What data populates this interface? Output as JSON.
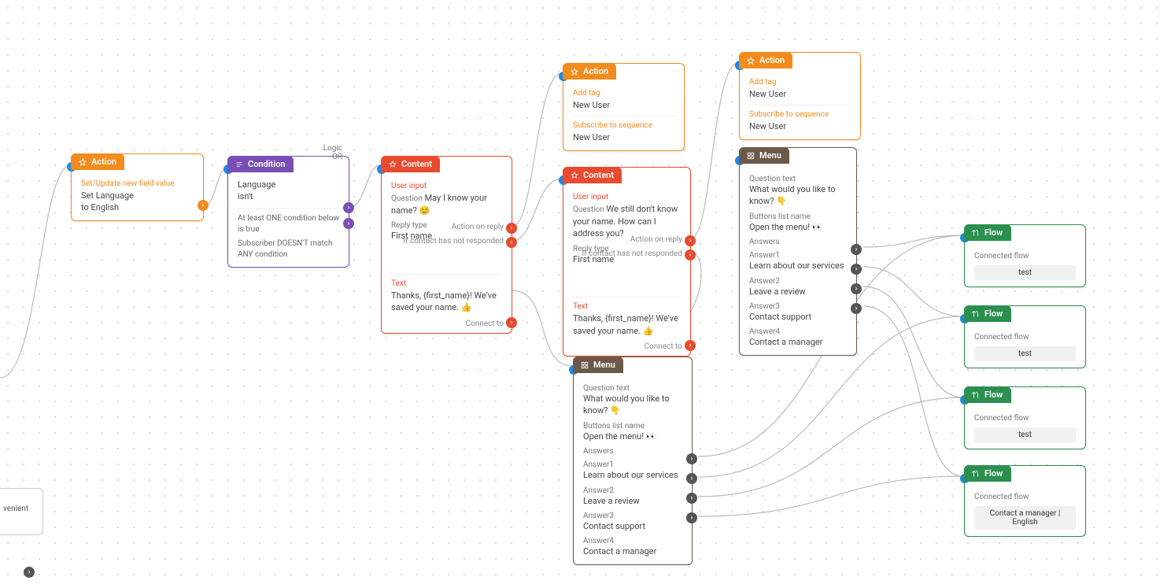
{
  "headers": {
    "action": "Action",
    "condition": "Condition",
    "content": "Content",
    "menu": "Menu",
    "flow": "Flow"
  },
  "nodes": {
    "action1": {
      "section": "Set/Update new field value",
      "line1": "Set Language",
      "line2": "to English"
    },
    "condition1": {
      "logic": "Logic\nOR",
      "field": "Language",
      "op": "isn't",
      "rule1": "At least ONE condition below is true",
      "rule2": "Subscriber DOESN'T match ANY condition"
    },
    "content1": {
      "sec": "User input",
      "q_lbl": "Question",
      "q_val": "May I know your name? 😊",
      "reply_lbl": "Reply type",
      "reply_val": "First name",
      "act_reply": "Action on reply",
      "no_resp": "If contact has not responded",
      "text_sec": "Text",
      "text_val": "Thanks, {first_name}! We've saved your name. 👍",
      "connect": "Connect to"
    },
    "action2": {
      "sec1": "Add tag",
      "val1": "New User",
      "sec2": "Subscribe to sequence",
      "val2": "New User"
    },
    "content2": {
      "sec": "User input",
      "q_lbl": "Question",
      "q_val": "We still don't know your name. How can I address you?",
      "reply_lbl": "Reply type",
      "reply_val": "First name",
      "act_reply": "Action on reply",
      "no_resp": "If contact has not responded",
      "text_sec": "Text",
      "text_val": "Thanks, {first_name}! We've saved your name. 👍",
      "connect": "Connect to"
    },
    "action3": {
      "sec1": "Add tag",
      "val1": "New User",
      "sec2": "Subscribe to sequence",
      "val2": "New User"
    },
    "menu1": {
      "q_lbl": "Question text",
      "q_val": "What would you like to know? 👇",
      "btn_lbl": "Buttons list name",
      "btn_val": "Open the menu! 👀",
      "ans_lbl": "Answers",
      "a1_lbl": "Answer1",
      "a1_val": "Learn about our services",
      "a2_lbl": "Answer2",
      "a2_val": "Leave a review",
      "a3_lbl": "Answer3",
      "a3_val": "Contact support",
      "a4_lbl": "Answer4",
      "a4_val": "Contact a manager"
    },
    "menu2": {
      "q_lbl": "Question text",
      "q_val": "What would you like to know? 👇",
      "btn_lbl": "Buttons list name",
      "btn_val": "Open the menu! 👀",
      "ans_lbl": "Answers",
      "a1_lbl": "Answer1",
      "a1_val": "Learn about our services",
      "a2_lbl": "Answer2",
      "a2_val": "Leave a review",
      "a3_lbl": "Answer3",
      "a3_val": "Contact support",
      "a4_lbl": "Answer4",
      "a4_val": "Contact a manager"
    },
    "flow1": {
      "lbl": "Connected flow",
      "val": "test"
    },
    "flow2": {
      "lbl": "Connected flow",
      "val": "test"
    },
    "flow3": {
      "lbl": "Connected flow",
      "val": "test"
    },
    "flow4": {
      "lbl": "Connected flow",
      "val": "Contact a manager | English"
    },
    "partial": {
      "text": "venient"
    }
  }
}
